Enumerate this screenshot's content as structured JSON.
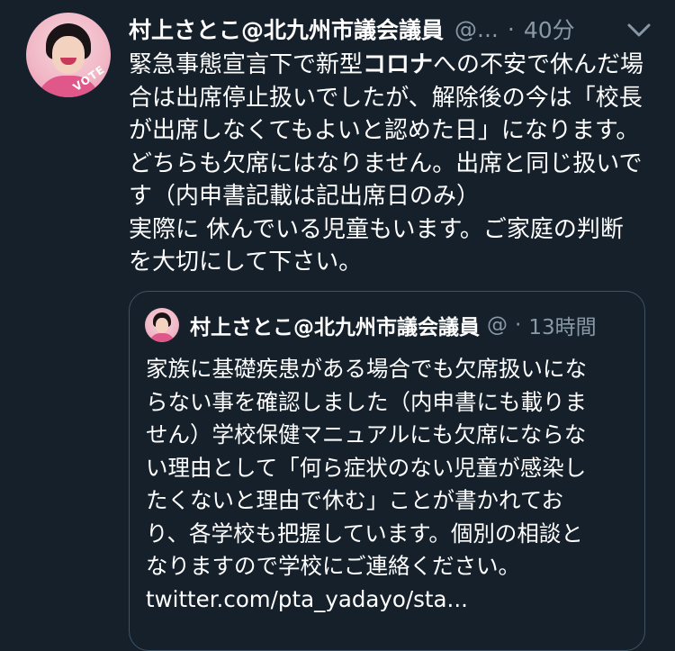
{
  "tweet": {
    "author_name": "村上さとこ@北九州市議会議員",
    "author_handle": "@...",
    "separator": "·",
    "time": "40分",
    "avatar_badge": "VOTE",
    "body_lines": [
      {
        "before": "緊急事態宣言下で新型",
        "bold": "コロナ",
        "after": "への不安で休んだ場"
      },
      {
        "before": "合は出席停止扱いでしたが、解除後の今は「校長",
        "bold": "",
        "after": ""
      },
      {
        "before": "が出席しなくてもよいと認めた日」になります。",
        "bold": "",
        "after": ""
      },
      {
        "before": "どちらも欠席にはなりません。出席と同じ扱いで",
        "bold": "",
        "after": ""
      },
      {
        "before": "す（内申書記載は記出席日のみ）",
        "bold": "",
        "after": ""
      },
      {
        "before": "実際に 休んでいる児童もいます。ご家庭の判断",
        "bold": "",
        "after": ""
      },
      {
        "before": "を大切にして下さい。",
        "bold": "",
        "after": ""
      }
    ]
  },
  "quoted_tweet": {
    "author_name": "村上さとこ@北九州市議会議員",
    "author_handle": "@",
    "separator": "·",
    "time": "13時間",
    "lines": [
      "家族に基礎疾患がある場合でも欠席扱いにな",
      "らない事を確認しました（内申書にも載りま",
      "せん）学校保健マニュアルにも欠席にならな",
      "い理由として「何ら症状のない児童が感染し",
      "たくないと理由で休む」ことが書かれてお",
      "り、各学校も把握しています。個別の相談と",
      "なりますので学校にご連絡ください。",
      "twitter.com/pta_yadayo/sta..."
    ]
  },
  "icons": {
    "menu": "chevron-down-icon"
  },
  "colors": {
    "background": "#15202b",
    "text_primary": "#ffffff",
    "text_secondary": "#8899a6",
    "border": "#3d5466"
  }
}
